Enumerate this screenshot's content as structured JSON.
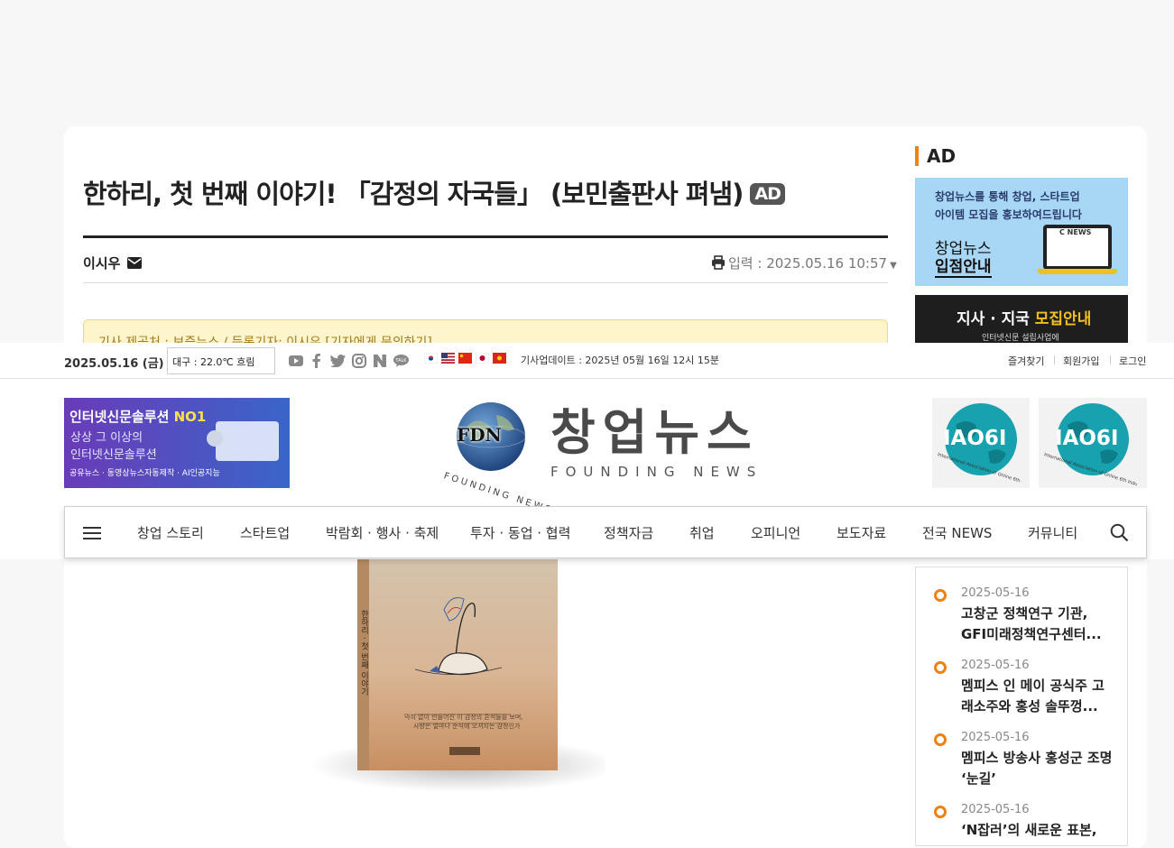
{
  "article": {
    "title": "한하리, 첫 번째 이야기! 「감정의 자국들」 (보민출판사 펴냄)",
    "badge": "AD",
    "author": "이시우",
    "date_label": "입력 : 2025.05.16 10:57",
    "notice": "기사 제공처 : 보증뉴스 / 등록기자: 이시우 [기자에게 문의하기]"
  },
  "book": {
    "spine_text": "한하리 · 첫 번째 이야기",
    "cover_line1": "막히 없이 만들어진 이 감정의 흔적들을 보며,",
    "cover_line2": "사랑은 얼마나 순식에 오셔지는 감정인가"
  },
  "sidebar": {
    "ad_heading": "AD",
    "ad1": {
      "line1": "창업뉴스를 통해 창업, 스타트업",
      "line2": "아이템 모집을 홍보하여드립니다",
      "line3": "창업뉴스",
      "line4": "입점안내",
      "screen": "C NEWS"
    },
    "ad2": {
      "title_a": "지사 · 지국",
      "title_b": "모집안내",
      "sub": "인터넷신문 설립사업에"
    },
    "news": [
      {
        "date": "2025-05-16",
        "title": "고창군 정책연구 기관, GFI미래정책연구센터..."
      },
      {
        "date": "2025-05-16",
        "title": "멤피스 인 메이 공식주 고래소주와 홍성 솔뚜껑..."
      },
      {
        "date": "2025-05-16",
        "title": "멤피스 방송사 홍성군 조명 ‘눈길’"
      },
      {
        "date": "2025-05-16",
        "title": "‘N잡러’의 새로운 표본,"
      }
    ]
  },
  "topbar": {
    "date": "2025.05.16 (금)",
    "weather": "대구 : 22.0℃ 흐림",
    "update": "기사업데이트 : 2025년 05월 16일 12시 15분",
    "links": [
      "즐겨찾기",
      "회원가입",
      "로그인"
    ]
  },
  "header": {
    "left_ad": {
      "line1a": "인터넷신문솔루션 ",
      "line1b": "NO1",
      "line2": "상상 그 이상의",
      "line3": "인터넷신문솔루션",
      "line4": "공유뉴스 · 동영상뉴스자동제작 · AI인공지능"
    },
    "logo": {
      "fdn": "FDN",
      "arc": "FOUNDING NEWS",
      "name": "창업뉴스",
      "sub": "FOUNDING NEWS"
    },
    "badges": [
      {
        "text": "IAO6I",
        "arc": "International Association of Online 6th Industries"
      },
      {
        "text": "IAO6I",
        "arc": "International Association of Online 6th Industries"
      }
    ]
  },
  "nav": {
    "items": [
      "창업 스토리",
      "스타트업",
      "박람회 · 행사 · 축제",
      "투자 · 동업 · 협력",
      "정책자금",
      "취업",
      "오피니언",
      "보도자료",
      "전국 NEWS",
      "커뮤니티"
    ]
  },
  "colors": {
    "accent": "#f08010",
    "dark": "#222222",
    "notice_bg": "#fff5cc",
    "ad_blue": "#a8d7f5"
  }
}
